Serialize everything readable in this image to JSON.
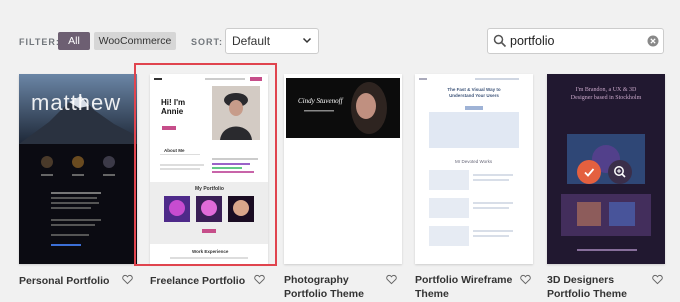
{
  "toolbar": {
    "filter_label": "FILTER:",
    "filter_all": "All",
    "filter_woo": "WooCommerce",
    "sort_label": "SORT:",
    "sort_value": "Default",
    "search_value": "portfolio"
  },
  "cards": [
    {
      "title": "Personal Portfolio",
      "thumb_text": "matthew"
    },
    {
      "title": "Freelance Portfolio",
      "thumb_heading": "Hi! I'm Annie",
      "thumb_about": "About Me",
      "thumb_portfolio": "My Portfolio",
      "thumb_work": "Work Experience"
    },
    {
      "title": "Photography Portfolio Theme",
      "thumb_text": "Cindy Stuvenoff"
    },
    {
      "title": "Portfolio Wireframe Theme",
      "thumb_heading": "The Fast & Visual Way to Understand Your Users",
      "thumb_section": "Mr Devoted Works"
    },
    {
      "title": "3D Designers Portfolio Theme",
      "thumb_heading": "I'm Brandon, a UX & 3D Designer based in Stockholm"
    }
  ],
  "colors": {
    "accent": "#6d5f72",
    "selected_border": "#e0444e",
    "install_button": "#e4603f"
  }
}
